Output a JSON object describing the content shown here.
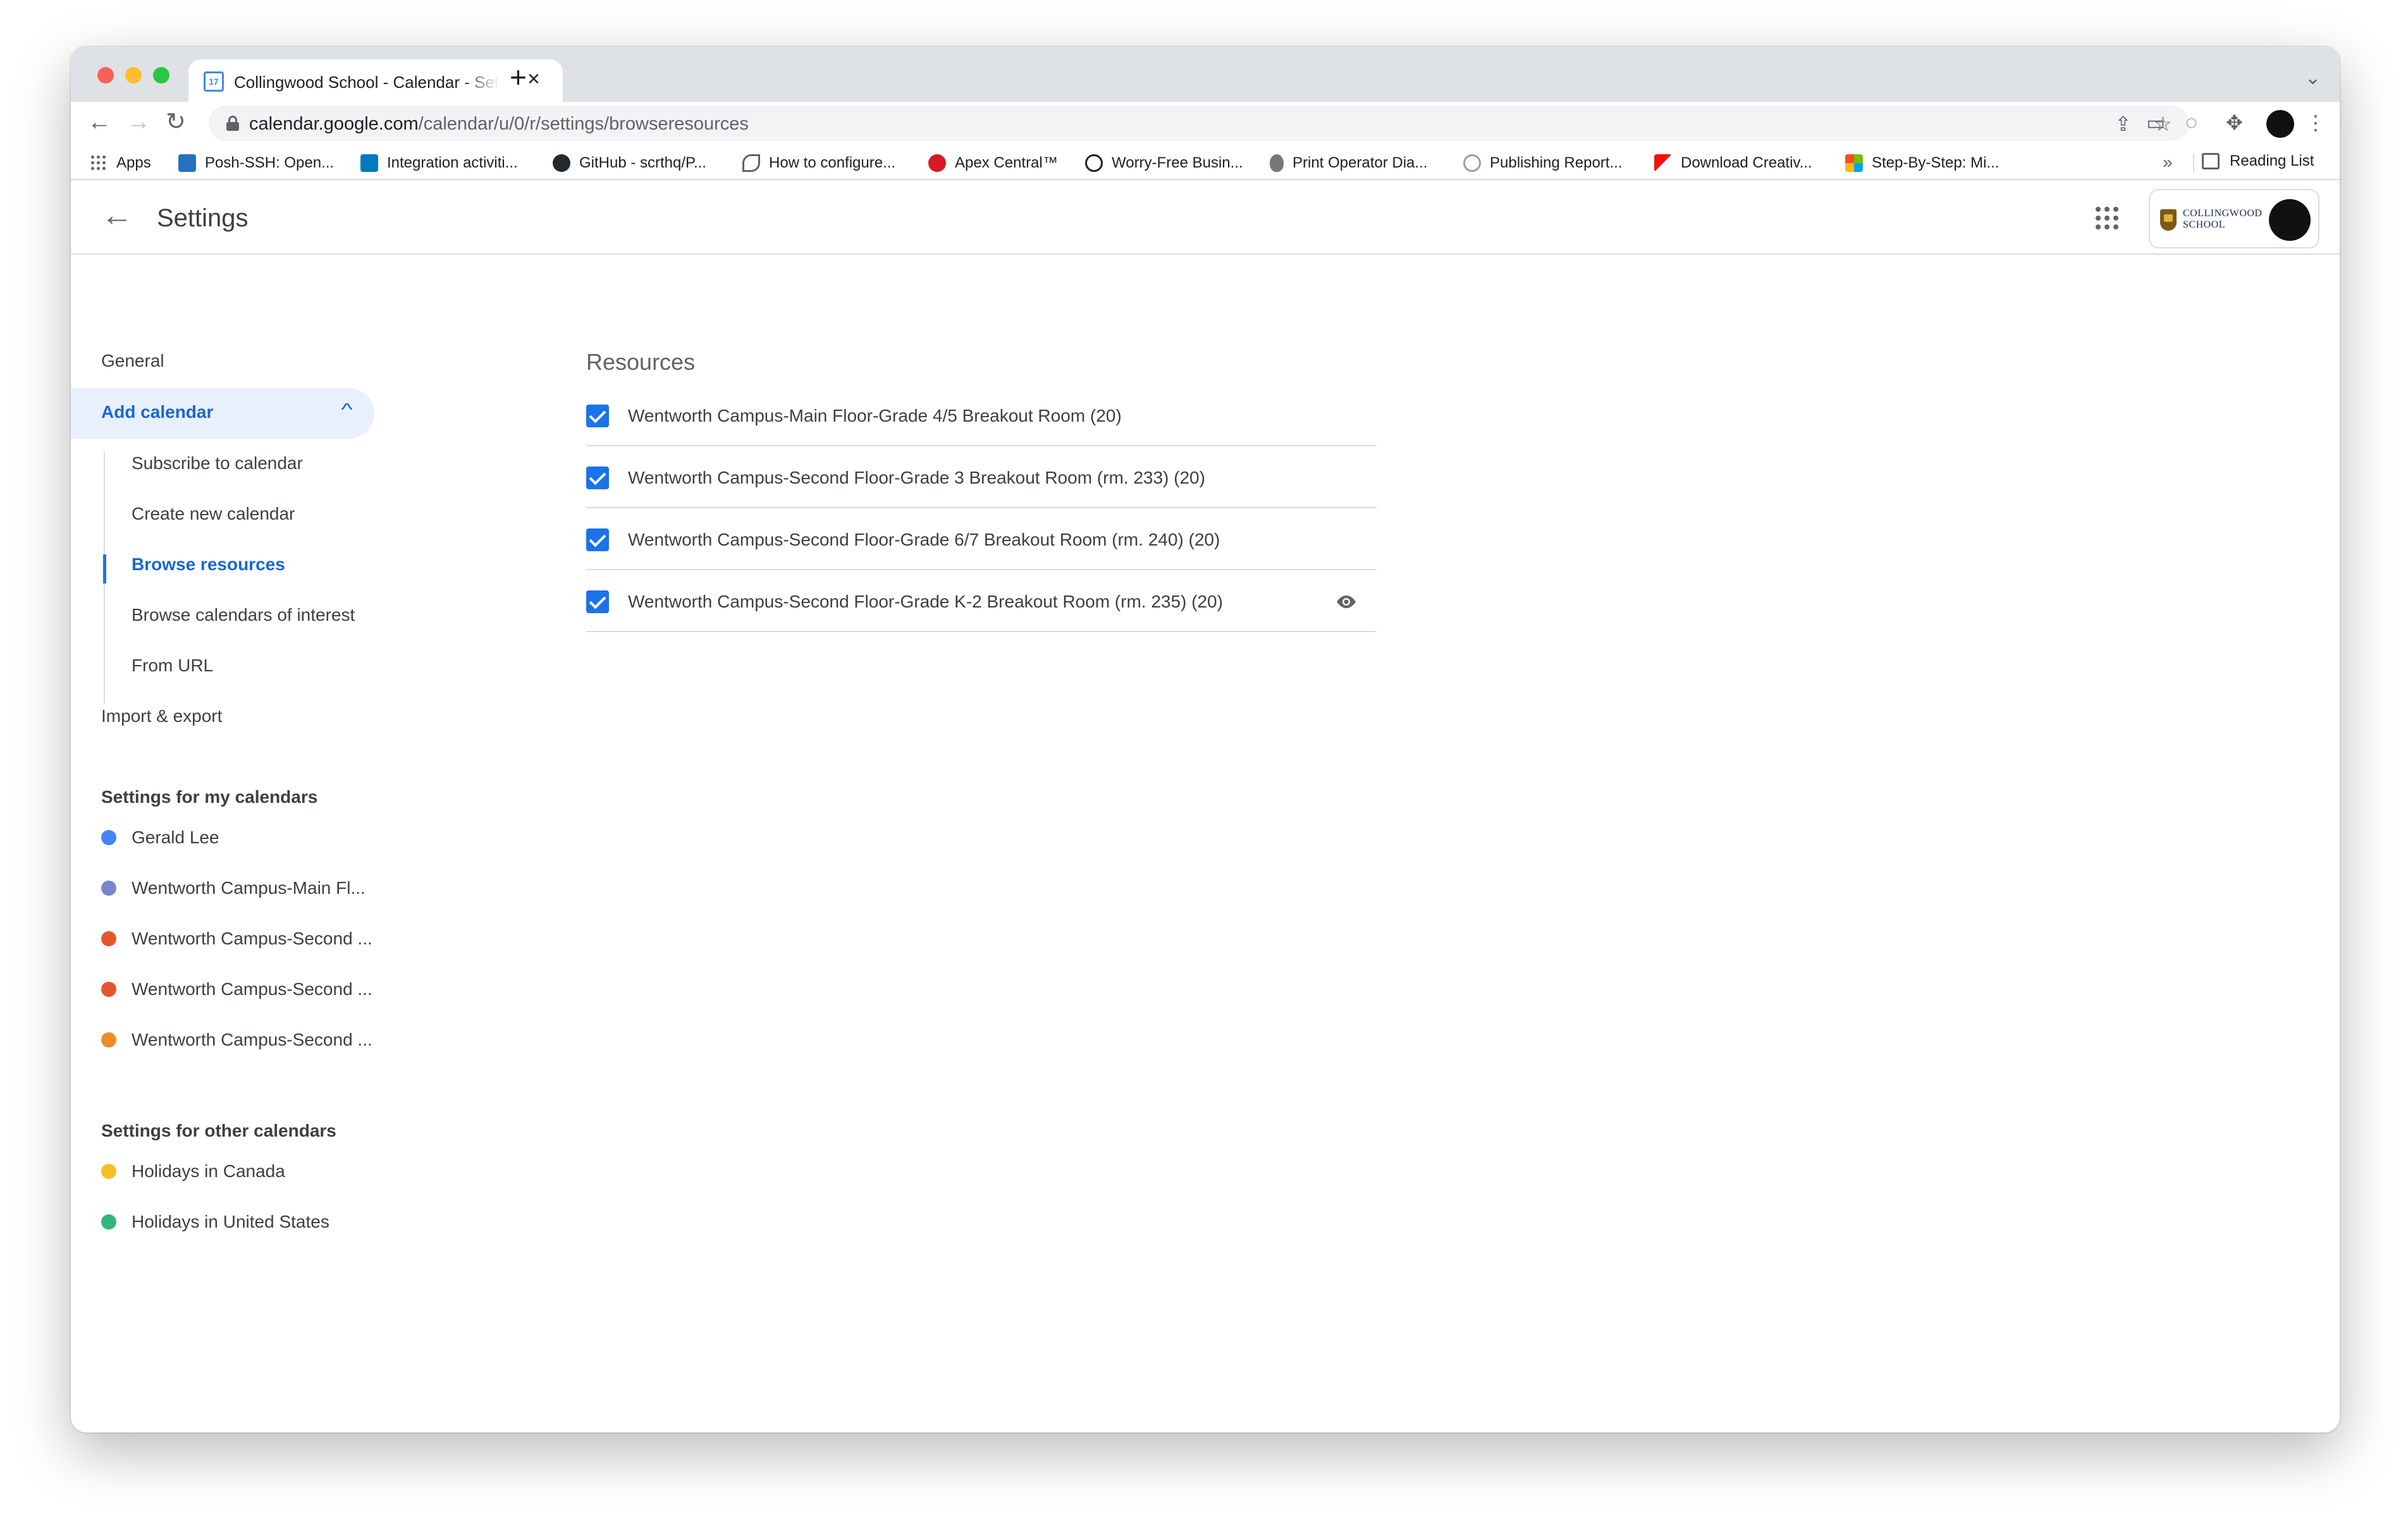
{
  "browser": {
    "tab_title": "Collingwood School - Calendar - Settings",
    "tab_favicon_text": "17",
    "url_host": "calendar.google.com",
    "url_path": "/calendar/u/0/r/settings/browseresources",
    "bookmarks": [
      {
        "label": "Apps",
        "icon": "apps-grid-icon",
        "color": "#5f6368"
      },
      {
        "label": "Posh-SSH: Open...",
        "icon": "powershell-icon",
        "color": "#2671be"
      },
      {
        "label": "Integration activiti...",
        "icon": "trello-icon",
        "color": "#0079bf"
      },
      {
        "label": "GitHub - scrthq/P...",
        "icon": "github-icon",
        "color": "#24292e"
      },
      {
        "label": "How to configure...",
        "icon": "wave-icon",
        "color": "#5f6368"
      },
      {
        "label": "Apex Central™",
        "icon": "trendmicro-icon",
        "color": "#d71921"
      },
      {
        "label": "Worry-Free Busin...",
        "icon": "globe-icon",
        "color": "#202124"
      },
      {
        "label": "Print Operator Dia...",
        "icon": "apple-icon",
        "color": "#777777"
      },
      {
        "label": "Publishing Report...",
        "icon": "globe-outline-icon",
        "color": "#9aa0a6"
      },
      {
        "label": "Download Creativ...",
        "icon": "adobe-icon",
        "color": "#fa0f00"
      },
      {
        "label": "Step-By-Step: Mi...",
        "icon": "microsoft-icon",
        "color": "#f25022"
      }
    ],
    "reading_list": "Reading List",
    "more_bookmarks": "»"
  },
  "header": {
    "title": "Settings",
    "org_name_line1": "COLLINGWOOD",
    "org_name_line2": "SCHOOL"
  },
  "sidebar": {
    "general": "General",
    "add_calendar": "Add calendar",
    "sub_items": [
      {
        "label": "Subscribe to calendar",
        "active": false
      },
      {
        "label": "Create new calendar",
        "active": false
      },
      {
        "label": "Browse resources",
        "active": true
      },
      {
        "label": "Browse calendars of interest",
        "active": false
      },
      {
        "label": "From URL",
        "active": false
      }
    ],
    "import_export": "Import & export",
    "my_calendars_title": "Settings for my calendars",
    "my_calendars": [
      {
        "label": "Gerald Lee",
        "color": "#4285f4"
      },
      {
        "label": "Wentworth Campus-Main Fl...",
        "color": "#7986cb"
      },
      {
        "label": "Wentworth Campus-Second ...",
        "color": "#e4572e"
      },
      {
        "label": "Wentworth Campus-Second ...",
        "color": "#e4572e"
      },
      {
        "label": "Wentworth Campus-Second ...",
        "color": "#ef8b2c"
      }
    ],
    "other_calendars_title": "Settings for other calendars",
    "other_calendars": [
      {
        "label": "Holidays in Canada",
        "color": "#f6bf26"
      },
      {
        "label": "Holidays in United States",
        "color": "#33b679"
      }
    ]
  },
  "main": {
    "heading": "Resources",
    "resources": [
      {
        "label": "Wentworth Campus-Main Floor-Grade 4/5 Breakout Room (20)",
        "checked": true
      },
      {
        "label": "Wentworth Campus-Second Floor-Grade 3 Breakout Room (rm. 233) (20)",
        "checked": true
      },
      {
        "label": "Wentworth Campus-Second Floor-Grade 6/7 Breakout Room (rm. 240) (20)",
        "checked": true
      },
      {
        "label": "Wentworth Campus-Second Floor-Grade K-2 Breakout Room (rm. 235) (20)",
        "checked": true
      }
    ]
  },
  "colors": {
    "accent": "#1a73e8",
    "active_text": "#1967d2",
    "active_bg": "#e8f0fe"
  }
}
